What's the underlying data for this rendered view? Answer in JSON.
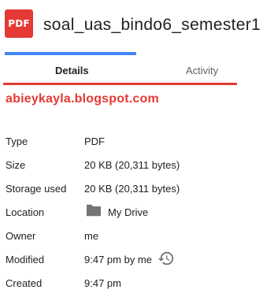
{
  "file": {
    "icon_label": "PDF",
    "title": "soal_uas_bindo6_semester1"
  },
  "tabs": [
    {
      "label": "Details",
      "active": true
    },
    {
      "label": "Activity",
      "active": false
    }
  ],
  "watermark": "abieykayla.blogspot.com",
  "details": {
    "type": {
      "label": "Type",
      "value": "PDF"
    },
    "size": {
      "label": "Size",
      "value": "20 KB (20,311 bytes)"
    },
    "storage": {
      "label": "Storage used",
      "value": "20 KB (20,311 bytes)"
    },
    "location": {
      "label": "Location",
      "value": "My Drive",
      "icon": "folder-icon"
    },
    "owner": {
      "label": "Owner",
      "value": "me"
    },
    "modified": {
      "label": "Modified",
      "value": "9:47 pm by me",
      "icon": "history-icon"
    },
    "created": {
      "label": "Created",
      "value": "9:47 pm"
    }
  },
  "colors": {
    "pdf_red": "#e53935",
    "tab_accent": "#4285f4",
    "watermark_red": "#e53935",
    "icon_gray": "#757575"
  }
}
